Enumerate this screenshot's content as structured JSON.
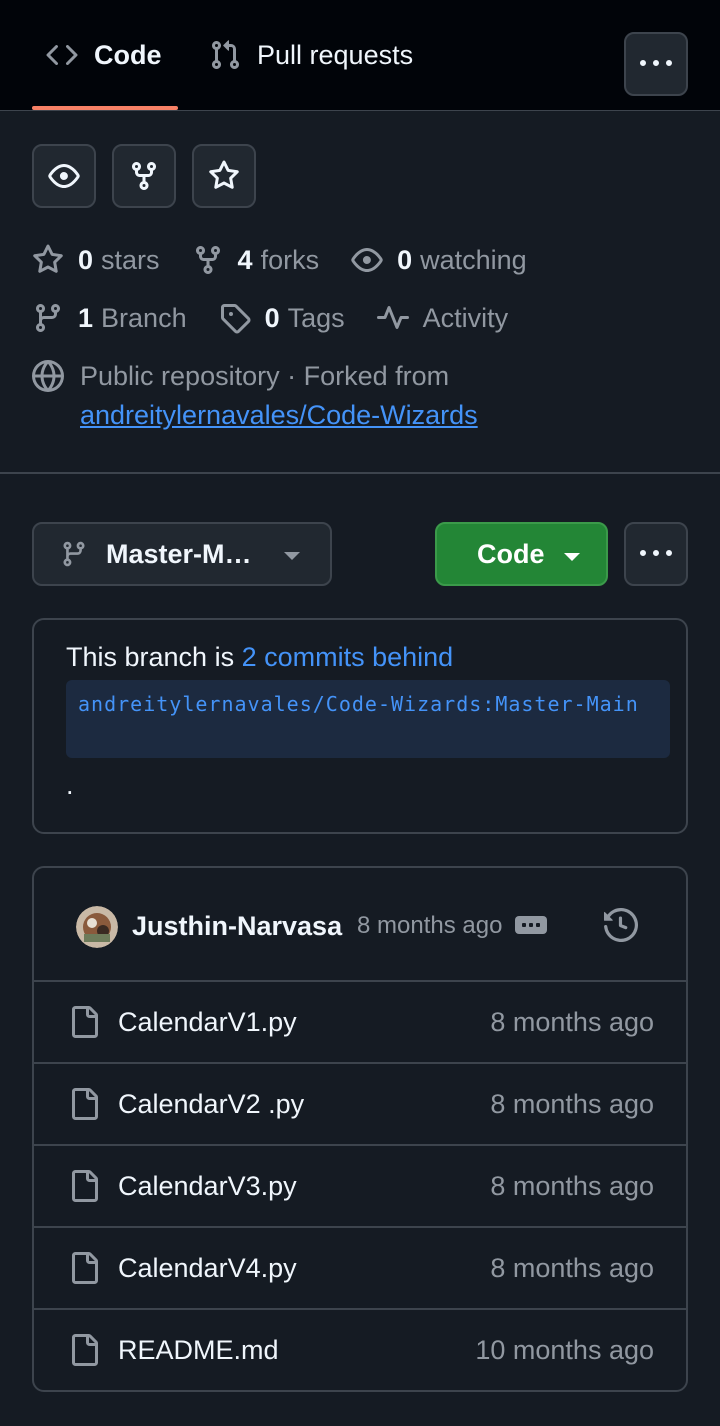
{
  "nav": {
    "tabs": [
      {
        "label": "Code",
        "icon": "code-icon",
        "active": true
      },
      {
        "label": "Pull requests",
        "icon": "git-pull-request-icon",
        "active": false
      }
    ],
    "more_icon": "kebab-horizontal-icon"
  },
  "actions": [
    "eye-icon",
    "repo-forked-icon",
    "star-icon"
  ],
  "stats": {
    "stars": {
      "count": "0",
      "label": "stars"
    },
    "forks": {
      "count": "4",
      "label": "forks"
    },
    "watching": {
      "count": "0",
      "label": "watching"
    },
    "branches": {
      "count": "1",
      "label": "Branch"
    },
    "tags": {
      "count": "0",
      "label": "Tags"
    },
    "activity": {
      "label": "Activity"
    }
  },
  "repo_info": {
    "visibility": "Public repository · Forked from",
    "fork_source": "andreitylernavales/Code-Wizards"
  },
  "branch_selector": {
    "name": "Master-M…"
  },
  "code_button": {
    "label": "Code"
  },
  "notice": {
    "prefix": "This branch is ",
    "link": "2 commits behind",
    "ref": "andreitylernavales/Code-Wizards:Master-Main",
    "suffix": "."
  },
  "latest_commit": {
    "author": "Justhin-Narvasa",
    "time": "8 months ago"
  },
  "files": [
    {
      "name": "CalendarV1.py",
      "time": "8 months ago"
    },
    {
      "name": "CalendarV2 .py",
      "time": "8 months ago"
    },
    {
      "name": "CalendarV3.py",
      "time": "8 months ago"
    },
    {
      "name": "CalendarV4.py",
      "time": "8 months ago"
    },
    {
      "name": "README.md",
      "time": "10 months ago"
    }
  ],
  "colors": {
    "background": "#151b23",
    "nav_background": "#010409",
    "border": "#3d444d",
    "accent_underline": "#f78166",
    "link": "#4493f8",
    "primary_button": "#238636",
    "muted_text": "#9198a1"
  }
}
